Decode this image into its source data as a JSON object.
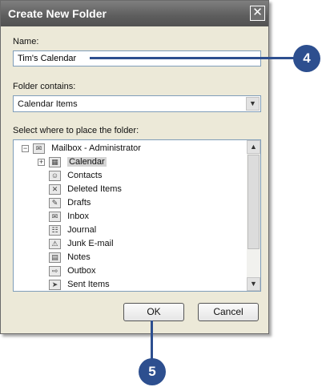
{
  "dialog": {
    "title": "Create New Folder",
    "close_label": "✕"
  },
  "name_field": {
    "label": "Name:",
    "value": "Tim's Calendar"
  },
  "contains_field": {
    "label": "Folder contains:",
    "value": "Calendar Items"
  },
  "location": {
    "label": "Select where to place the folder:",
    "root": "Mailbox - Administrator",
    "items": [
      {
        "label": "Calendar",
        "icon": "calendar-icon",
        "expander": "+"
      },
      {
        "label": "Contacts",
        "icon": "contacts-icon"
      },
      {
        "label": "Deleted Items",
        "icon": "trash-icon"
      },
      {
        "label": "Drafts",
        "icon": "drafts-icon"
      },
      {
        "label": "Inbox",
        "icon": "inbox-icon"
      },
      {
        "label": "Journal",
        "icon": "journal-icon"
      },
      {
        "label": "Junk E-mail",
        "icon": "junk-mail-icon"
      },
      {
        "label": "Notes",
        "icon": "notes-icon"
      },
      {
        "label": "Outbox",
        "icon": "outbox-icon"
      },
      {
        "label": "Sent Items",
        "icon": "sent-items-icon"
      }
    ]
  },
  "buttons": {
    "ok": "OK",
    "cancel": "Cancel"
  },
  "callouts": {
    "name": "4",
    "ok": "5"
  },
  "colors": {
    "callout": "#2d4f8f",
    "titlebar": "#5d5d5d",
    "dialog_bg": "#ece9d8"
  }
}
